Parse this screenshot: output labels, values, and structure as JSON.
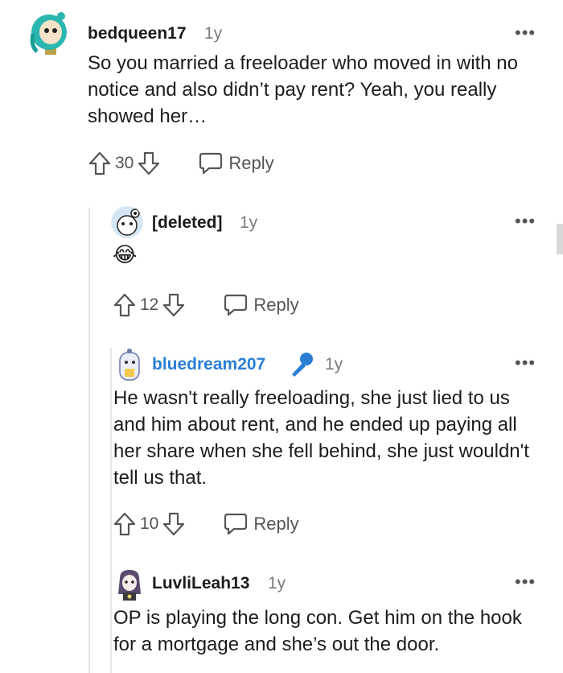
{
  "comments": [
    {
      "username": "bedqueen17",
      "age": "1y",
      "body": "So you married a freeloader who moved in with no notice and also didn’t pay rent? Yeah, you really showed her…",
      "votes": "30",
      "reply_label": "Reply",
      "more_label": "•••"
    },
    {
      "username": "[deleted]",
      "age": "1y",
      "body": "😂",
      "votes": "12",
      "reply_label": "Reply",
      "more_label": "•••"
    },
    {
      "username": "bluedream207",
      "age": "1y",
      "body": "He wasn't really freeloading, she just lied to us and him about rent, and he ended up paying all her share when she fell behind, she just wouldn't tell us that.",
      "votes": "10",
      "reply_label": "Reply",
      "more_label": "•••",
      "username_color": "#2a7fd4",
      "badge_icon": "microphone-icon"
    },
    {
      "username": "LuvliLeah13",
      "age": "1y",
      "body": "OP is playing the long con. Get him on the hook for a mortgage and she’s out the door.",
      "more_label": "•••"
    }
  ]
}
